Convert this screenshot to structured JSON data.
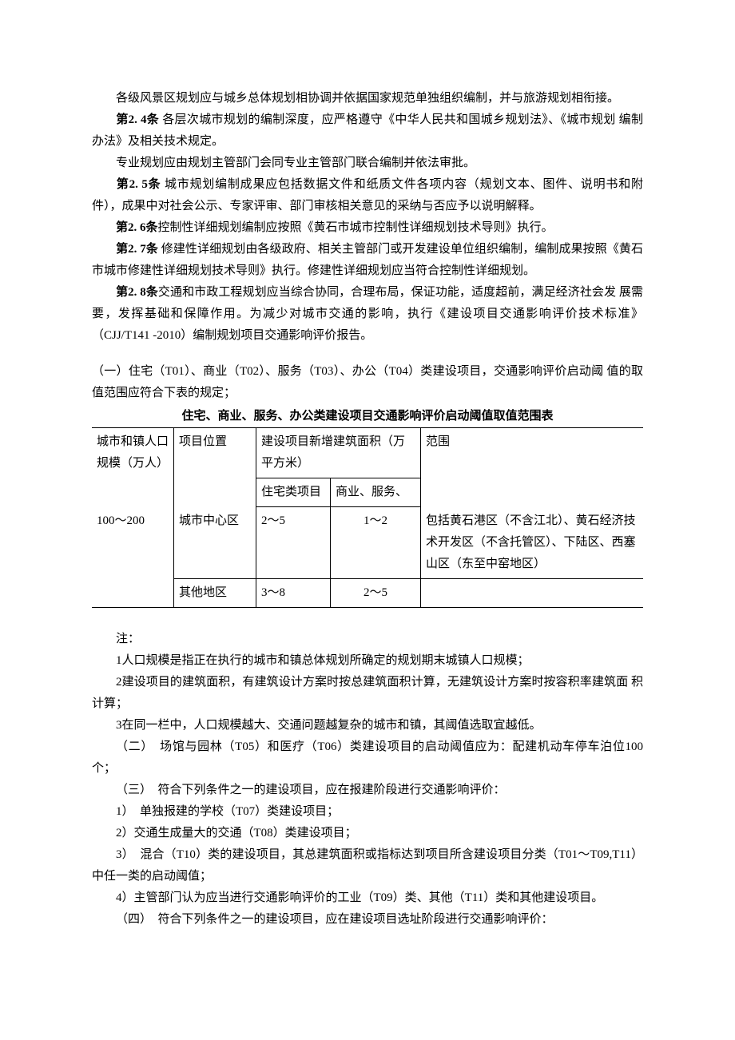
{
  "paragraphs": {
    "p1": "各级风景区规划应与城乡总体规划相协调并依据国家规范单独组织编制，并与旅游规划相衔接。",
    "p2_label": "第2. 4条",
    "p2_text": " 各层次城市规划的编制深度，应严格遵守《中华人民共和国城乡规划法》、《城市规划 编制办法》及相关技术规定。",
    "p3": "专业规划应由规划主管部门会同专业主管部门联合编制并依法审批。",
    "p4_label": "第2. 5条",
    "p4_text": " 城市规划编制成果应包括数据文件和纸质文件各项内容（规划文本、图件、说明书和附 件），成果中对社会公示、专家评审、部门审核相关意见的采纳与否应予以说明解释。",
    "p5_label": "第2. 6条",
    "p5_text": "控制性详细规划编制应按照《黄石市城市控制性详细规划技术导则》执行。",
    "p6_label": "第2. 7条",
    "p6_text": " 修建性详细规划由各级政府、相关主管部门或开发建设单位组织编制，编制成果按照《黄石市城市修建性详细规划技术导则》执行。修建性详细规划应当符合控制性详细规划。",
    "p7_label": "第2. 8条",
    "p7_text": "交通和市政工程规划应当综合协同，合理布局，保证功能，适度超前，满足经济社会发 展需要，发挥基础和保障作用。为减少对城市交通的影响，执行《建设项目交通影响评价技术标准》 （CJJ/T141 -2010）编制规划项目交通影响评价报告。",
    "p8": "（一）住宅（T01）、商业（T02）、服务（T03）、办公（T04）类建设项目，交通影响评价启动阈 值的取值范围应符合下表的规定；"
  },
  "table": {
    "caption": "住宅、商业、服务、办公类建设项目交通影响评价启动阈值取值范围表",
    "headers": {
      "col1": "城市和镇人口规模（万人）",
      "col2": "项目位置",
      "col3_group": "建设项目新增建筑面积（万平方米）",
      "col3a": "住宅类项目",
      "col3b": "商业、服务、",
      "col4": "范围"
    },
    "rows": [
      {
        "c1": "100～200",
        "c2": "城市中心区",
        "c3a": "2～5",
        "c3b": "1～2",
        "c4": "包括黄石港区（不含江北）、黄石经济技术开发区（不含托管区）、下陆区、西塞山区（东至中窑地区）"
      },
      {
        "c1": "",
        "c2": "其他地区",
        "c3a": "3～8",
        "c3b": "2～5",
        "c4": ""
      }
    ]
  },
  "notes": {
    "label": "注：",
    "n1": "1人口规模是指正在执行的城市和镇总体规划所确定的规划期末城镇人口规模；",
    "n2": "2建设项目的建筑面积，有建筑设计方案时按总建筑面积计算，无建筑设计方案时按容积率建筑面 积计算；",
    "n3": "3在同一栏中，人口规模越大、交通问题越复杂的城市和镇，其阈值选取宜越低。",
    "p_two": "（二）　场馆与园林（T05）和医疗（T06）类建设项目的启动阈值应为：配建机动车停车泊位100个；",
    "p_three": "（三）　符合下列条件之一的建设项目，应在报建阶段进行交通影响评价：",
    "p3_1": "1）　单独报建的学校（T07）类建设项目；",
    "p3_2": "2）交通生成量大的交通（T08）类建设项目；",
    "p3_3": "3）　混合（T10）类的建设项目，其总建筑面积或指标达到项目所含建设项目分类（T01～T09,T11）中任一类的启动阈值；",
    "p3_4": "4）主管部门认为应当进行交通影响评价的工业（T09）类、其他（T11）类和其他建设项目。",
    "p_four": "（四）　符合下列条件之一的建设项目，应在建设项目选址阶段进行交通影响评价："
  }
}
